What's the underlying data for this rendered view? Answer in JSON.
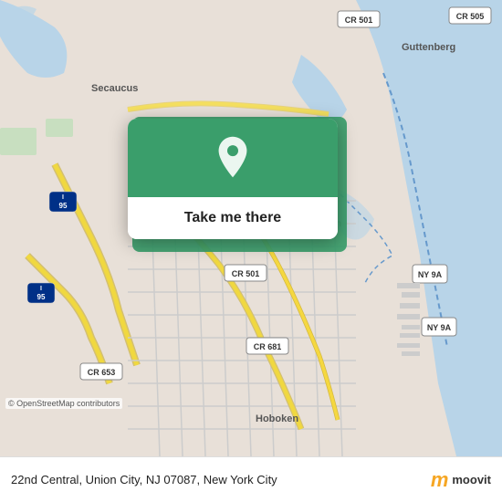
{
  "map": {
    "background_color": "#e8e0d8"
  },
  "popup": {
    "button_label": "Take me there",
    "pin_color": "#ffffff"
  },
  "bottom_bar": {
    "address": "22nd Central, Union City, NJ 07087, New York City",
    "osm_credit": "© OpenStreetMap contributors",
    "moovit_m": "m",
    "moovit_label": "moovit"
  }
}
